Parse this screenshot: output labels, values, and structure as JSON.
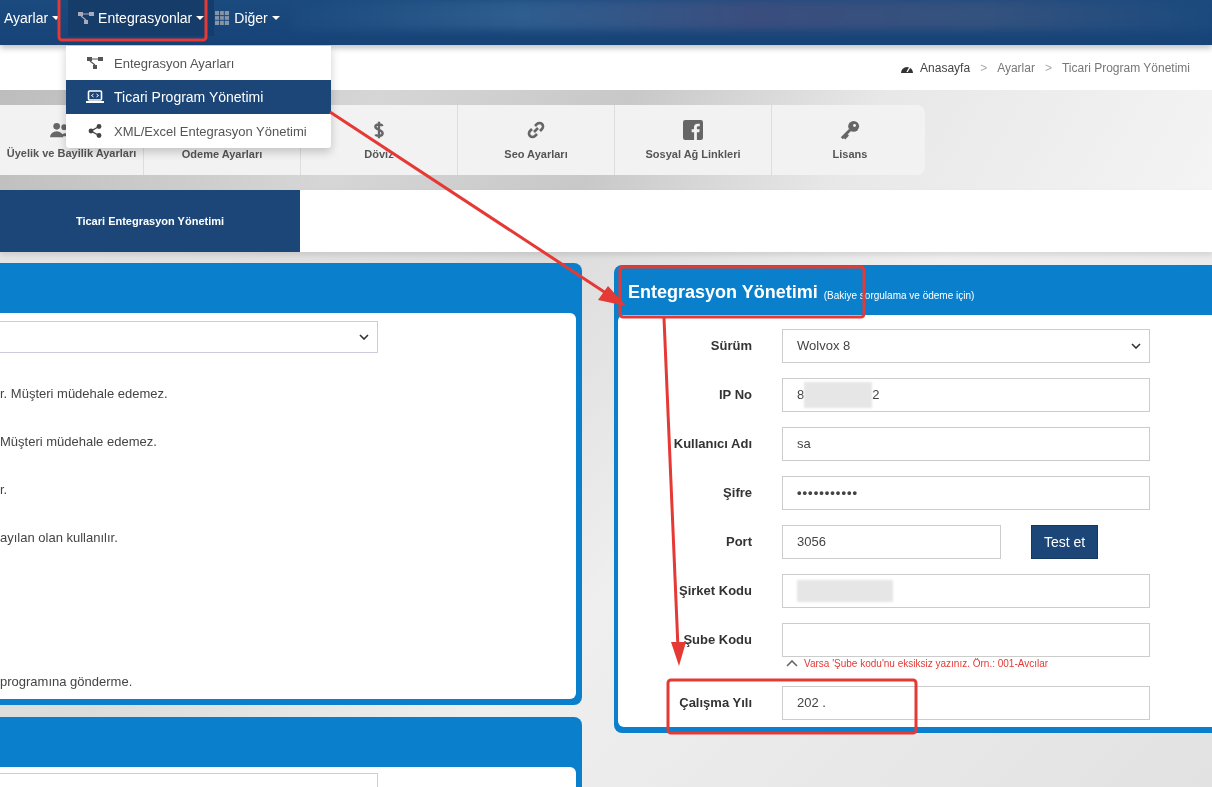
{
  "nav": {
    "items": [
      {
        "label": "Ayarlar",
        "selected": false
      },
      {
        "label": "Entegrasyonlar",
        "selected": true
      },
      {
        "label": "Diğer",
        "selected": false
      }
    ]
  },
  "dropdown": {
    "items": [
      {
        "label": "Entegrasyon Ayarları",
        "selected": false
      },
      {
        "label": "Ticari Program Yönetimi",
        "selected": true
      },
      {
        "label": "XML/Excel Entegrasyon Yönetimi",
        "selected": false
      }
    ]
  },
  "breadcrumb": {
    "separator": ">",
    "items": [
      "Anasayfa",
      "Ayarlar",
      "Ticari Program Yönetimi"
    ]
  },
  "settings_tabs": [
    {
      "label": "Üyelik ve Bayilik Ayarları"
    },
    {
      "label": "Odeme Ayarları"
    },
    {
      "label": "Döviz"
    },
    {
      "label": "Seo Ayarları"
    },
    {
      "label": "Sosyal Ağ Linkleri"
    },
    {
      "label": "Lisans"
    }
  ],
  "sub_tabs": [
    {
      "label": "Ticari Entegrasyon Yönetimi",
      "selected": true
    }
  ],
  "left_panel": {
    "lines": [
      "r. Müşteri müdehale edemez.",
      " Müşteri müdehale edemez.",
      "r.",
      "ayılan olan kullanılır.",
      "programına gönderme."
    ]
  },
  "right_panel": {
    "title": "Entegrasyon Yönetimi",
    "subtitle": "(Bakiye sorgulama ve ödeme için)",
    "fields": [
      {
        "label": "Sürüm",
        "kind": "select",
        "value": "Wolvox 8"
      },
      {
        "label": "IP No",
        "kind": "redacted",
        "value": "8",
        "value_end": "2"
      },
      {
        "label": "Kullanıcı Adı",
        "kind": "text",
        "value": "sa"
      },
      {
        "label": "Şifre",
        "kind": "password",
        "value": "•••••••••••"
      },
      {
        "label": "Port",
        "kind": "button",
        "value": "3056",
        "button": "Test et"
      },
      {
        "label": "Şirket Kodu",
        "kind": "redacted"
      },
      {
        "label": "Şube Kodu",
        "kind": "text",
        "hint": "Varsa 'Şube kodu'nu eksiksiz yazınız. Örn.: 001-Avcılar"
      },
      {
        "label": "Çalışma Yılı",
        "kind": "text",
        "value": "202 ."
      }
    ]
  }
}
